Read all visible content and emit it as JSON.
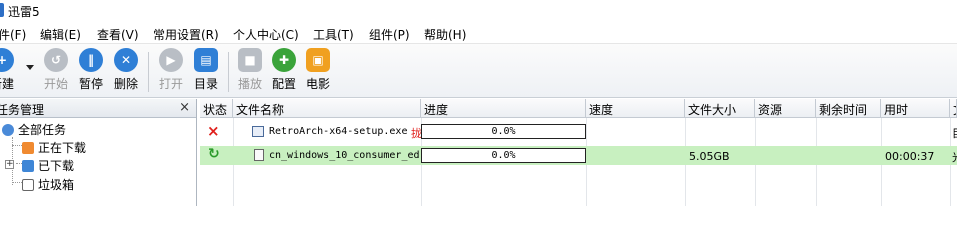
{
  "window": {
    "title": "迅雷5"
  },
  "menu": [
    "件(F)",
    "编辑(E)",
    "查看(V)",
    "常用设置(R)",
    "个人中心(C)",
    "工具(T)",
    "组件(P)",
    "帮助(H)"
  ],
  "toolbar": {
    "new": "新建",
    "start": "开始",
    "pause": "暂停",
    "delete": "删除",
    "open": "打开",
    "folder": "目录",
    "play": "播放",
    "config": "配置",
    "movie": "电影"
  },
  "task_panel": {
    "title": "任务管理",
    "close": "×",
    "items": [
      "全部任务",
      "正在下载",
      "已下载",
      "垃圾箱"
    ]
  },
  "columns": [
    "状态",
    "文件名称",
    "进度",
    "速度",
    "文件大小",
    "资源",
    "剩余时间",
    "用时",
    "文"
  ],
  "rows": [
    {
      "status_icon": "×",
      "file_name": "RetroArch-x64-setup.exe",
      "progress": "0.0%",
      "progress_value": 0.0,
      "speed": "",
      "size": "",
      "resources": "",
      "remaining": "",
      "elapsed": "",
      "last": "目",
      "name_suffix": "拢"
    },
    {
      "status_icon": "↻",
      "file_name": "cn_windows_10_consumer_ed",
      "progress": "0.0%",
      "progress_value": 0.0,
      "speed": "",
      "size": "5.05GB",
      "resources": "",
      "remaining": "",
      "elapsed": "00:00:37",
      "last": "光",
      "name_suffix": ""
    }
  ],
  "colors": {
    "selected_row": "#c8f0c0",
    "error_x": "#e0201c",
    "running_arrow": "#2a9a2a"
  }
}
